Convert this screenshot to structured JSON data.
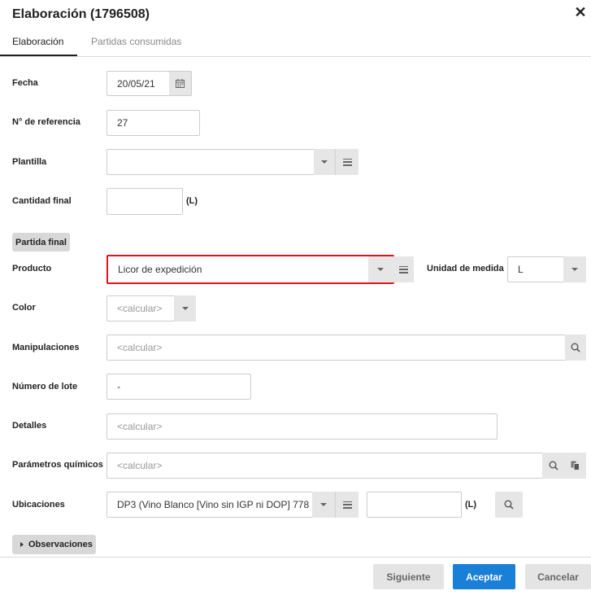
{
  "dialog": {
    "title": "Elaboración (1796508)",
    "close_symbol": "✕"
  },
  "tabs": [
    {
      "label": "Elaboración",
      "active": true
    },
    {
      "label": "Partidas consumidas",
      "active": false
    }
  ],
  "form": {
    "fecha": {
      "label": "Fecha",
      "value": "20/05/21"
    },
    "referencia": {
      "label": "N° de referencia",
      "value": "27"
    },
    "plantilla": {
      "label": "Plantilla",
      "value": ""
    },
    "cantidad_final": {
      "label": "Cantidad final",
      "value": "",
      "unit": "(L)"
    },
    "section_chip": "Partida final",
    "producto": {
      "label": "Producto",
      "value": "Licor de expedición"
    },
    "unidad_medida": {
      "label": "Unidad de medida",
      "value": "L"
    },
    "color": {
      "label": "Color",
      "placeholder": "<calcular>"
    },
    "manipulaciones": {
      "label": "Manipulaciones",
      "placeholder": "<calcular>"
    },
    "numero_lote": {
      "label": "Número de lote",
      "value": "-"
    },
    "detalles": {
      "label": "Detalles",
      "placeholder": "<calcular>"
    },
    "parametros": {
      "label": "Parámetros químicos",
      "placeholder": "<calcular>"
    },
    "ubicaciones": {
      "label": "Ubicaciones",
      "value": "DP3 (Vino Blanco [Vino sin IGP ni DOP] 778",
      "qty": "",
      "unit": "(L)"
    },
    "observaciones": "Observaciones"
  },
  "footer": {
    "next": "Siguiente",
    "accept": "Aceptar",
    "cancel": "Cancelar"
  },
  "colors": {
    "accent": "#1a7fd6",
    "highlight": "#e0141e"
  }
}
